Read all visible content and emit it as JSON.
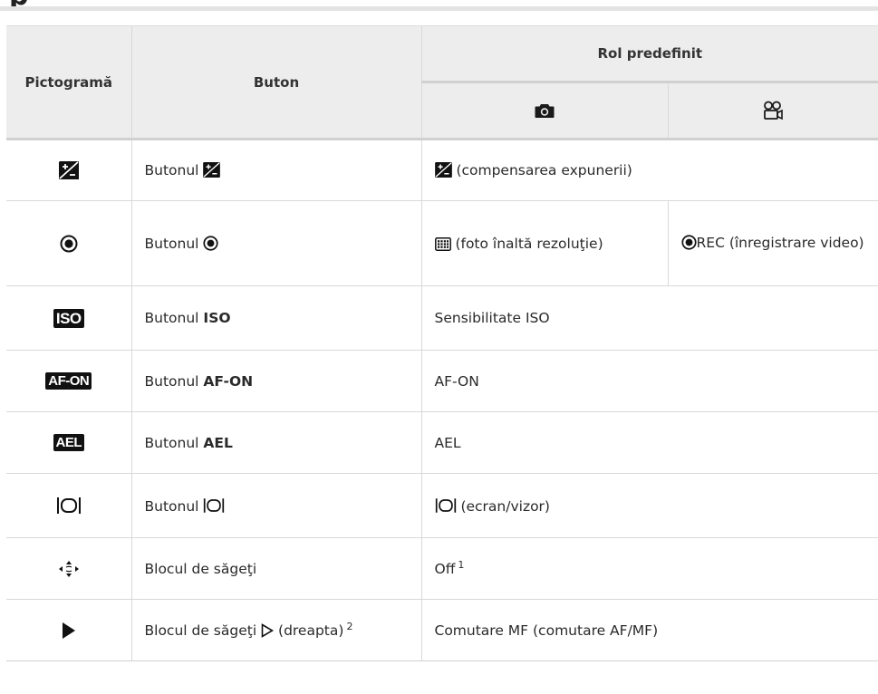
{
  "headings": {
    "pictograma": "Pictogramă",
    "buton": "Buton",
    "rol_predefinit": "Rol predefinit"
  },
  "icons": {
    "camera": "camera-icon",
    "movie": "movie-icon",
    "exposure_comp": "exposure-compensation-icon",
    "record": "record-icon",
    "high_res": "high-res-shot-icon",
    "iso": "ISO",
    "af_on": "AF-ON",
    "ael": "AEL",
    "lv": "lv-switch-icon",
    "arrow_pad": "arrow-pad-icon",
    "play": "play-triangle-icon"
  },
  "rows": [
    {
      "button_prefix": "Butonul",
      "role": "(compensarea expunerii)"
    },
    {
      "button_prefix": "Butonul",
      "role_photo": "(foto înaltă rezoluţie)",
      "role_movie": "REC (înregistrare video)"
    },
    {
      "button_prefix": "Butonul",
      "button_key": "ISO",
      "role": "Sensibilitate ISO"
    },
    {
      "button_prefix": "Butonul",
      "button_key": "AF-ON",
      "role": "AF-ON"
    },
    {
      "button_prefix": "Butonul",
      "button_key": "AEL",
      "role": "AEL"
    },
    {
      "button_prefix": "Butonul",
      "role": "(ecran/vizor)"
    },
    {
      "button": "Blocul de săgeţi",
      "role": "Off",
      "role_note": "1"
    },
    {
      "button_prefix": "Blocul de săgeţi",
      "button_suffix": "(dreapta)",
      "button_note": "2",
      "role": "Comutare MF (comutare AF/MF)"
    }
  ],
  "colors": {
    "header_bg": "#ededed",
    "border": "#d9d9d9",
    "text": "#222222"
  }
}
